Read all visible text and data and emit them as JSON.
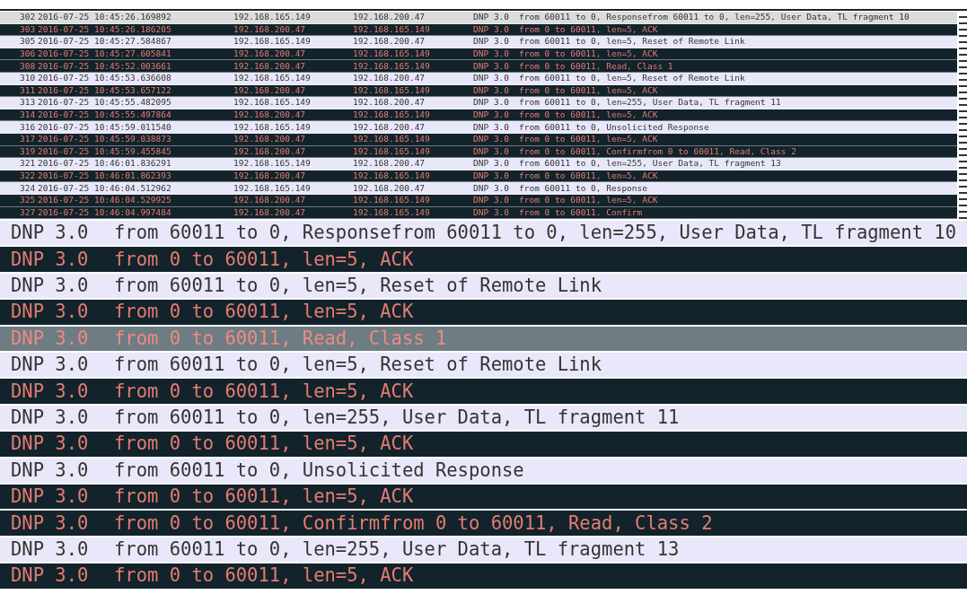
{
  "packet_list": {
    "rows": [
      {
        "no": "302",
        "time": "2016-07-25 10:45:26.169892",
        "source": "192.168.165.149",
        "destination": "192.168.200.47",
        "protocol": "DNP 3.0",
        "info": "from 60011 to 0, Responsefrom 60011 to 0, len=255, User Data, TL fragment 10",
        "kind": "light",
        "selected": true
      },
      {
        "no": "303",
        "time": "2016-07-25 10:45:26.186205",
        "source": "192.168.200.47",
        "destination": "192.168.165.149",
        "protocol": "DNP 3.0",
        "info": "from 0 to 60011, len=5, ACK",
        "kind": "dark",
        "selected": false
      },
      {
        "no": "305",
        "time": "2016-07-25 10:45:27.584867",
        "source": "192.168.165.149",
        "destination": "192.168.200.47",
        "protocol": "DNP 3.0",
        "info": "from 60011 to 0, len=5, Reset of Remote Link",
        "kind": "light",
        "selected": false
      },
      {
        "no": "306",
        "time": "2016-07-25 10:45:27.605841",
        "source": "192.168.200.47",
        "destination": "192.168.165.149",
        "protocol": "DNP 3.0",
        "info": "from 0 to 60011, len=5, ACK",
        "kind": "dark",
        "selected": false
      },
      {
        "no": "308",
        "time": "2016-07-25 10:45:52.003661",
        "source": "192.168.200.47",
        "destination": "192.168.165.149",
        "protocol": "DNP 3.0",
        "info": "from 0 to 60011, Read, Class 1",
        "kind": "dark",
        "selected": false
      },
      {
        "no": "310",
        "time": "2016-07-25 10:45:53.636608",
        "source": "192.168.165.149",
        "destination": "192.168.200.47",
        "protocol": "DNP 3.0",
        "info": "from 60011 to 0, len=5, Reset of Remote Link",
        "kind": "light",
        "selected": false
      },
      {
        "no": "311",
        "time": "2016-07-25 10:45:53.657122",
        "source": "192.168.200.47",
        "destination": "192.168.165.149",
        "protocol": "DNP 3.0",
        "info": "from 0 to 60011, len=5, ACK",
        "kind": "dark",
        "selected": false
      },
      {
        "no": "313",
        "time": "2016-07-25 10:45:55.482095",
        "source": "192.168.165.149",
        "destination": "192.168.200.47",
        "protocol": "DNP 3.0",
        "info": "from 60011 to 0, len=255, User Data, TL fragment 11",
        "kind": "light",
        "selected": false
      },
      {
        "no": "314",
        "time": "2016-07-25 10:45:55.497864",
        "source": "192.168.200.47",
        "destination": "192.168.165.149",
        "protocol": "DNP 3.0",
        "info": "from 0 to 60011, len=5, ACK",
        "kind": "dark",
        "selected": false
      },
      {
        "no": "316",
        "time": "2016-07-25 10:45:59.011540",
        "source": "192.168.165.149",
        "destination": "192.168.200.47",
        "protocol": "DNP 3.0",
        "info": "from 60011 to 0, Unsolicited Response",
        "kind": "light",
        "selected": false
      },
      {
        "no": "317",
        "time": "2016-07-25 10:45:59.038873",
        "source": "192.168.200.47",
        "destination": "192.168.165.149",
        "protocol": "DNP 3.0",
        "info": "from 0 to 60011, len=5, ACK",
        "kind": "dark",
        "selected": false
      },
      {
        "no": "319",
        "time": "2016-07-25 10:45:59.455845",
        "source": "192.168.200.47",
        "destination": "192.168.165.149",
        "protocol": "DNP 3.0",
        "info": "from 0 to 60011, Confirmfrom 0 to 60011, Read, Class 2",
        "kind": "dark",
        "selected": false
      },
      {
        "no": "321",
        "time": "2016-07-25 10:46:01.836291",
        "source": "192.168.165.149",
        "destination": "192.168.200.47",
        "protocol": "DNP 3.0",
        "info": "from 60011 to 0, len=255, User Data, TL fragment 13",
        "kind": "light",
        "selected": false
      },
      {
        "no": "322",
        "time": "2016-07-25 10:46:01.862393",
        "source": "192.168.200.47",
        "destination": "192.168.165.149",
        "protocol": "DNP 3.0",
        "info": "from 0 to 60011, len=5, ACK",
        "kind": "dark",
        "selected": false
      },
      {
        "no": "324",
        "time": "2016-07-25 10:46:04.512962",
        "source": "192.168.165.149",
        "destination": "192.168.200.47",
        "protocol": "DNP 3.0",
        "info": "from 60011 to 0, Response",
        "kind": "light",
        "selected": false
      },
      {
        "no": "325",
        "time": "2016-07-25 10:46:04.529925",
        "source": "192.168.200.47",
        "destination": "192.168.165.149",
        "protocol": "DNP 3.0",
        "info": "from 0 to 60011, len=5, ACK",
        "kind": "dark",
        "selected": false
      },
      {
        "no": "327",
        "time": "2016-07-25 10:46:04.997484",
        "source": "192.168.200.47",
        "destination": "192.168.165.149",
        "protocol": "DNP 3.0",
        "info": "from 0 to 60011. Confirm",
        "kind": "dark",
        "selected": false
      }
    ]
  },
  "zoomed_list": {
    "rows": [
      {
        "protocol": "DNP 3.0",
        "info": "from 60011 to 0, Responsefrom 60011 to 0, len=255, User Data, TL fragment 10",
        "kind": "light",
        "selected": false
      },
      {
        "protocol": "DNP 3.0",
        "info": "from 0 to 60011, len=5, ACK",
        "kind": "dark",
        "selected": false
      },
      {
        "protocol": "DNP 3.0",
        "info": "from 60011 to 0, len=5, Reset of Remote Link",
        "kind": "light",
        "selected": false
      },
      {
        "protocol": "DNP 3.0",
        "info": "from 0 to 60011, len=5, ACK",
        "kind": "dark",
        "selected": false
      },
      {
        "protocol": "DNP 3.0",
        "info": "from 0 to 60011, Read, Class 1",
        "kind": "dark",
        "selected": true
      },
      {
        "protocol": "DNP 3.0",
        "info": "from 60011 to 0, len=5, Reset of Remote Link",
        "kind": "light",
        "selected": false
      },
      {
        "protocol": "DNP 3.0",
        "info": "from 0 to 60011, len=5, ACK",
        "kind": "dark",
        "selected": false
      },
      {
        "protocol": "DNP 3.0",
        "info": "from 60011 to 0, len=255, User Data, TL fragment 11",
        "kind": "light",
        "selected": false
      },
      {
        "protocol": "DNP 3.0",
        "info": "from 0 to 60011, len=5, ACK",
        "kind": "dark",
        "selected": false
      },
      {
        "protocol": "DNP 3.0",
        "info": "from 60011 to 0, Unsolicited Response",
        "kind": "light",
        "selected": false
      },
      {
        "protocol": "DNP 3.0",
        "info": "from 0 to 60011, len=5, ACK",
        "kind": "dark",
        "selected": false
      },
      {
        "protocol": "DNP 3.0",
        "info": "from 0 to 60011, Confirmfrom 0 to 60011, Read, Class 2",
        "kind": "dark",
        "selected": false
      },
      {
        "protocol": "DNP 3.0",
        "info": "from 60011 to 0, len=255, User Data, TL fragment 13",
        "kind": "light",
        "selected": false
      },
      {
        "protocol": "DNP 3.0",
        "info": "from 0 to 60011, len=5, ACK",
        "kind": "dark",
        "selected": false
      }
    ]
  }
}
